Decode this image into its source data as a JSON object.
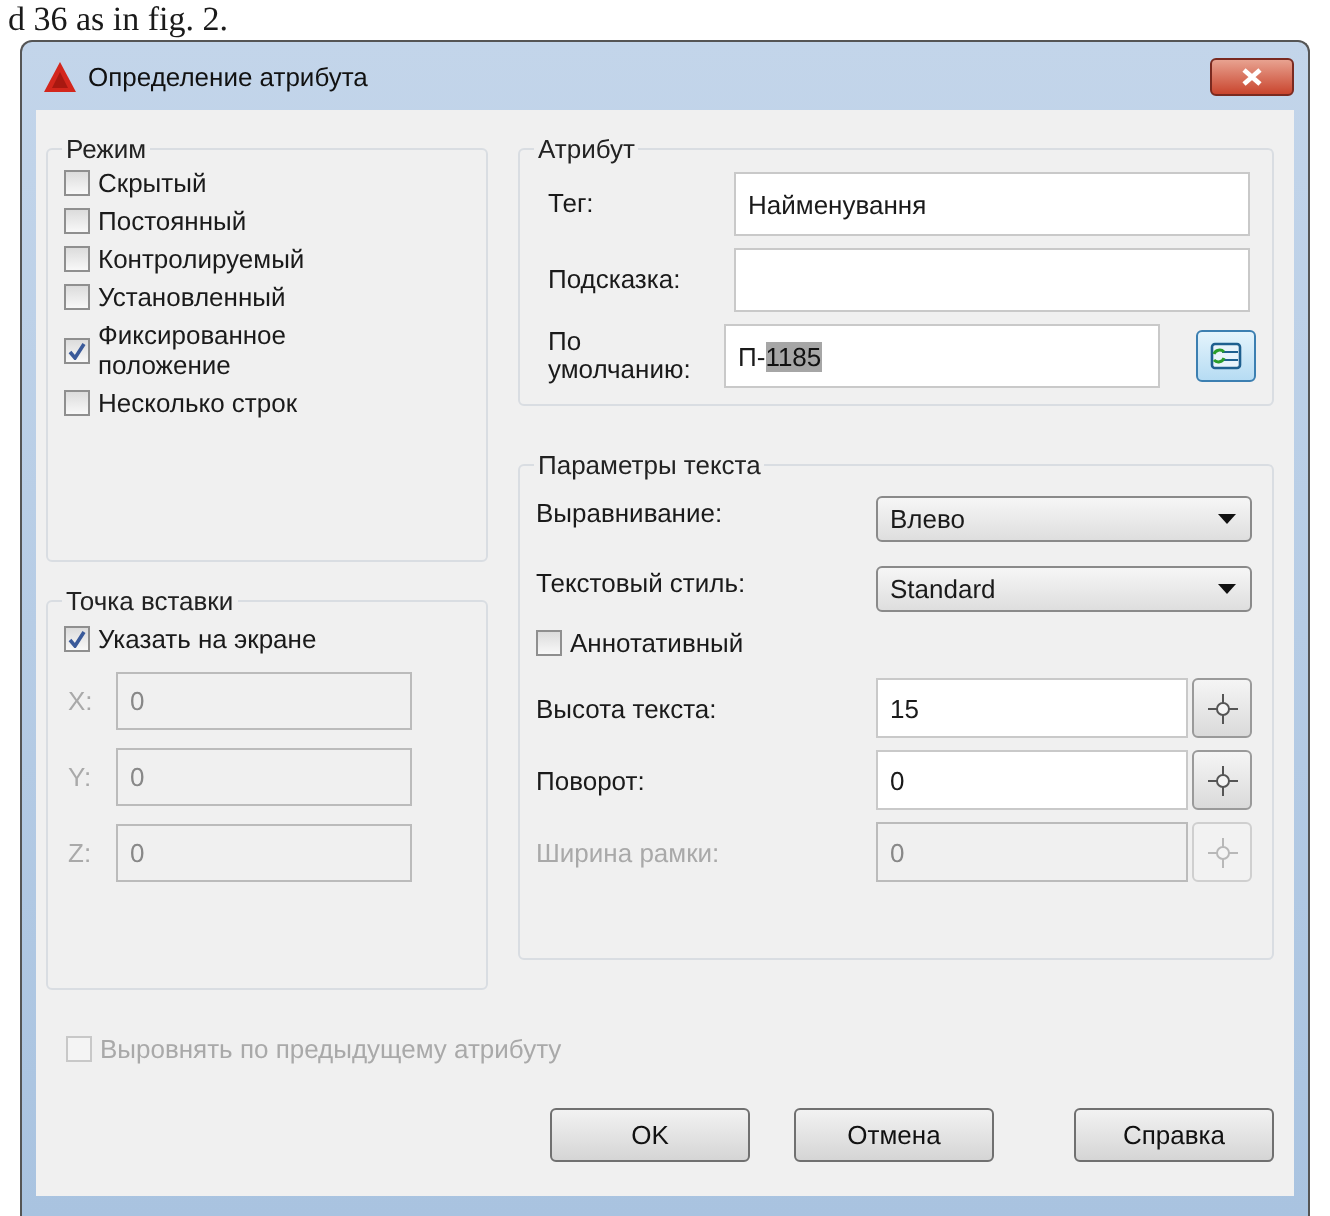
{
  "document_caption": "d 36 as in fig. 2.",
  "window": {
    "title": "Определение атрибута"
  },
  "mode": {
    "title": "Режим",
    "options": [
      {
        "label": "Скрытый",
        "checked": false
      },
      {
        "label": "Постоянный",
        "checked": false
      },
      {
        "label": "Контролируемый",
        "checked": false
      },
      {
        "label": "Установленный",
        "checked": false
      },
      {
        "label": "Фиксированное положение",
        "checked": true
      },
      {
        "label": "Несколько строк",
        "checked": false
      }
    ]
  },
  "insertion_point": {
    "title": "Точка вставки",
    "on_screen": {
      "label": "Указать на экране",
      "checked": true
    },
    "coords": [
      {
        "label": "X:",
        "value": "0",
        "disabled": true
      },
      {
        "label": "Y:",
        "value": "0",
        "disabled": true
      },
      {
        "label": "Z:",
        "value": "0",
        "disabled": true
      }
    ]
  },
  "attribute": {
    "title": "Атрибут",
    "fields": [
      {
        "kind": "text",
        "label": "Тег:",
        "value": "Найменування"
      },
      {
        "kind": "text",
        "label": "Подсказка:"
      },
      {
        "kind": "insert",
        "label": "По умолчанию:",
        "value": "П-",
        "selected_value": "1185"
      }
    ]
  },
  "text_settings": {
    "title": "Параметры текста",
    "rows": [
      {
        "kind": "dropdown",
        "label": "Выравнивание:",
        "value": "Влево"
      },
      {
        "kind": "dropdown",
        "label": "Текстовый стиль:",
        "value": "Standard"
      },
      {
        "kind": "checkbox",
        "label": "Аннотативный",
        "checked": false
      },
      {
        "kind": "pick",
        "label": "Высота текста:",
        "value": "15",
        "disabled": false
      },
      {
        "kind": "pick",
        "label": "Поворот:",
        "value": "0",
        "disabled": false
      },
      {
        "kind": "pick",
        "label": "Ширина рамки:",
        "value": "0",
        "disabled": true
      }
    ]
  },
  "align_previous": {
    "label": "Выровнять по предыдущему атрибуту",
    "checked": false,
    "disabled": true
  },
  "buttons": [
    {
      "label": "OK"
    },
    {
      "label": "Отмена"
    },
    {
      "label": "Справка"
    }
  ]
}
